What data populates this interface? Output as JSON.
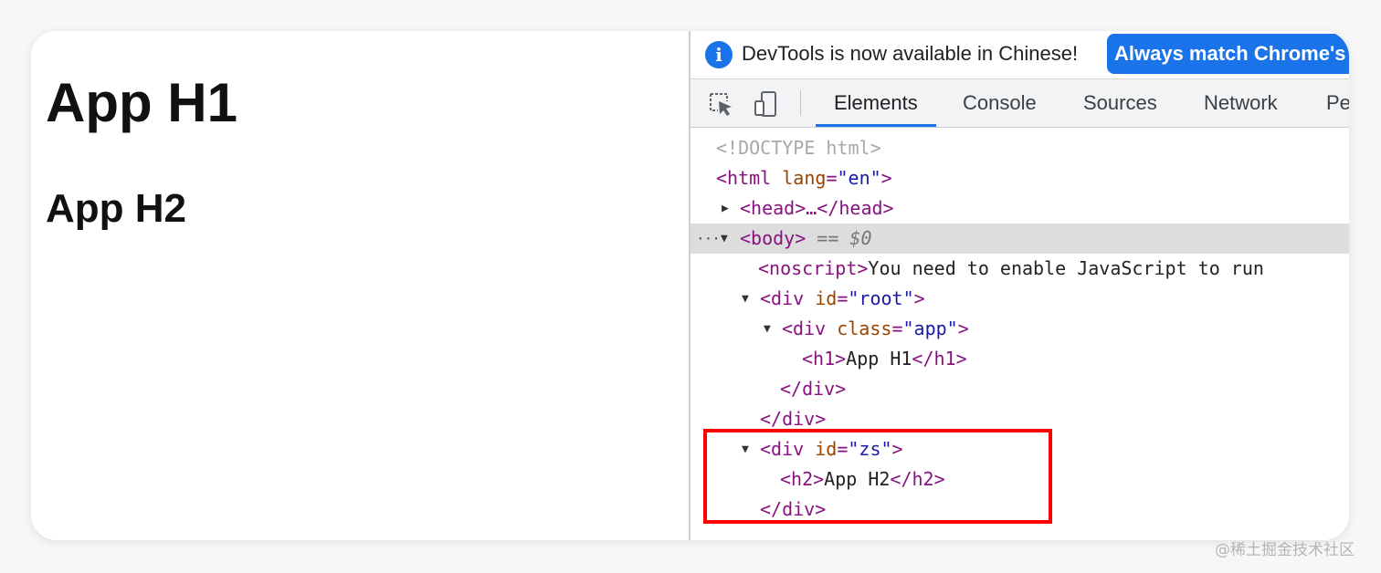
{
  "page": {
    "h1": "App H1",
    "h2": "App H2"
  },
  "devtools": {
    "infobar": {
      "icon": "info-icon",
      "icon_glyph": "i",
      "message": "DevTools is now available in Chinese!",
      "button_label": "Always match Chrome's"
    },
    "toolbar": {
      "icons": [
        "inspect-element-icon",
        "device-toolbar-icon"
      ],
      "tabs": [
        {
          "label": "Elements",
          "active": true
        },
        {
          "label": "Console",
          "active": false
        },
        {
          "label": "Sources",
          "active": false
        },
        {
          "label": "Network",
          "active": false
        },
        {
          "label": "Pe",
          "active": false
        }
      ]
    },
    "dom_tree": {
      "doctype": "<!DOCTYPE html>",
      "html_open": "<html",
      "html_attr": "lang",
      "html_val": "\"en\"",
      "html_close": ">",
      "head": "<head>…</head>",
      "body_tag": "<body>",
      "body_eq": "== $0",
      "noscript_tag": "<noscript>",
      "noscript_text": "You need to enable JavaScript to run",
      "div_open": "<div",
      "id_attr": "id",
      "class_attr": "class",
      "root_val": "\"root\"",
      "app_val": "\"app\"",
      "zs_val": "\"zs\"",
      "tag_close": ">",
      "h1_open": "<h1>",
      "h1_text": "App H1",
      "h1_close": "</h1>",
      "h2_open": "<h2>",
      "h2_text": "App H2",
      "h2_close": "</h2>",
      "div_end": "</div>",
      "expanded_glyph": "▼",
      "collapsed_glyph": "▶",
      "ellipsis": "···"
    }
  },
  "colors": {
    "accent": "#1a73e8",
    "highlight_box": "#ff0000",
    "tag": "#881280",
    "attr_name": "#994500",
    "attr_value": "#1a1aa6"
  },
  "watermark": "@稀土掘金技术社区"
}
